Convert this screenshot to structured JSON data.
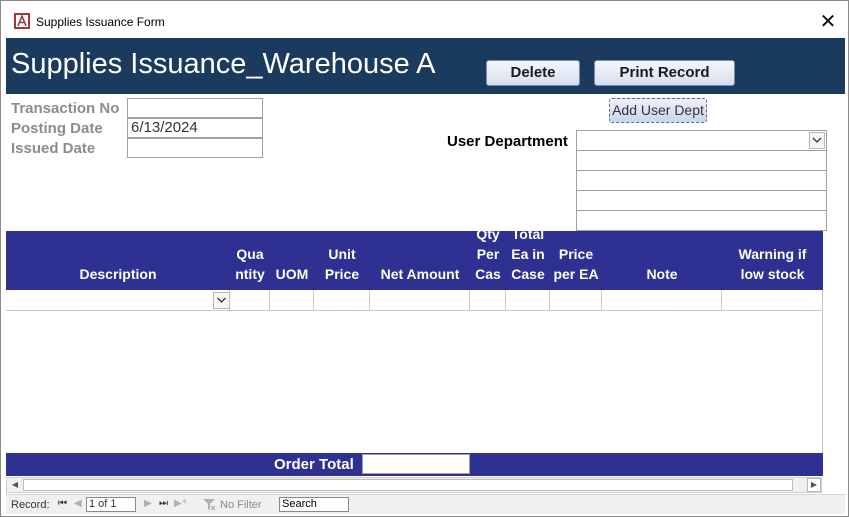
{
  "window": {
    "title": "Supplies Issuance Form",
    "close_glyph": "✕"
  },
  "header": {
    "title": "Supplies Issuance_Warehouse A",
    "delete_label": "Delete",
    "print_label": "Print Record",
    "bg_color": "#1a3a5e"
  },
  "fields": {
    "transaction_no_label": "Transaction No",
    "transaction_no_value": "",
    "posting_date_label": "Posting Date",
    "posting_date_value": "6/13/2024",
    "issued_date_label": "Issued Date",
    "issued_date_value": "",
    "add_user_dept_label": "Add User Dept",
    "user_department_label": "User Department",
    "user_department_value": ""
  },
  "grid": {
    "header_color": "#2e3092",
    "columns": [
      {
        "label": "Description"
      },
      {
        "label": "Qua\nntity"
      },
      {
        "label": "UOM"
      },
      {
        "label": "Unit\nPrice"
      },
      {
        "label": "Net Amount"
      },
      {
        "label": "Qty\nPer\nCas"
      },
      {
        "label": "Total\nEa in\nCase"
      },
      {
        "label": "Price\nper EA"
      },
      {
        "label": "Note"
      },
      {
        "label": "Warning if\nlow stock"
      }
    ]
  },
  "footer": {
    "order_total_label": "Order Total",
    "order_total_value": ""
  },
  "statusbar": {
    "record_label": "Record:",
    "record_value": "1 of 1",
    "no_filter_label": "No Filter",
    "search_label": "Search",
    "first_glyph": "⏮",
    "prev_glyph": "◀",
    "next_glyph": "▶",
    "last_glyph": "⏭",
    "new_glyph": "▶*"
  }
}
